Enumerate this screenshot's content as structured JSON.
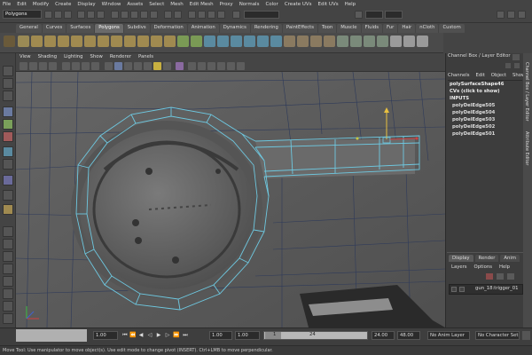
{
  "menubar": [
    "File",
    "Edit",
    "Modify",
    "Create",
    "Display",
    "Window",
    "Assets",
    "Select",
    "Mesh",
    "Edit Mesh",
    "Proxy",
    "Normals",
    "Color",
    "Create UVs",
    "Edit UVs",
    "Help"
  ],
  "mode_menu": "Polygons",
  "shelf_tabs": [
    "General",
    "Curves",
    "Surfaces",
    "Polygons",
    "Subdivs",
    "Deformation",
    "Animation",
    "Dynamics",
    "Rendering",
    "PaintEffects",
    "Toon",
    "Muscle",
    "Fluids",
    "Fur",
    "Hair",
    "nCloth",
    "Custom"
  ],
  "shelf_active": "Polygons",
  "viewport_menu": [
    "View",
    "Shading",
    "Lighting",
    "Show",
    "Renderer",
    "Panels"
  ],
  "channel_box": {
    "title": "Channel Box / Layer Editor",
    "menu": [
      "Channels",
      "Edit",
      "Object",
      "Show"
    ],
    "shape": "polySurfaceShape46",
    "cvs": "CVs (click to show)",
    "inputs_label": "INPUTS",
    "inputs": [
      "polyDelEdge505",
      "polyDelEdge504",
      "polyDelEdge503",
      "polyDelEdge502",
      "polyDelEdge501"
    ]
  },
  "right_tabs": [
    "Channel Box / Layer Editor",
    "Attribute Editor"
  ],
  "layer_editor": {
    "tabs": [
      "Display",
      "Render",
      "Anim"
    ],
    "menu": [
      "Layers",
      "Options",
      "Help"
    ],
    "layer_name": "gun_18:trigger_01"
  },
  "time_slider": {
    "start_field": "1.00",
    "current_field": "1.00",
    "range_start": "1.00",
    "range_inner_start": "1.00",
    "range_marker": "1",
    "range_inner_end": "24",
    "end_field": "24.00",
    "anim_end": "48.00",
    "anim_layer": "No Anim Layer",
    "character_set": "No Character Set"
  },
  "help_line": "Move Tool: Use manipulator to move object(s). Use edit mode to change pivot (INSERT). Ctrl+LMB to move perpendicular.",
  "colors": {
    "wire": "#6ec8e0",
    "viewport_bg": "#5a5a5a",
    "panel_bg": "#3d3d3d"
  }
}
